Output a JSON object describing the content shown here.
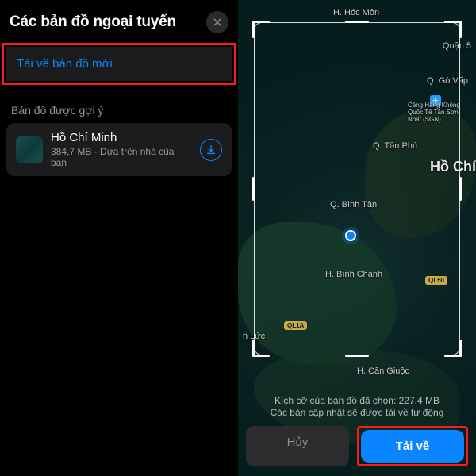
{
  "left": {
    "title": "Các bản đồ ngoại tuyến",
    "new_map_label": "Tải về bản đồ mới",
    "suggested_header": "Bản đồ được gợi ý",
    "suggested": {
      "name": "Hồ Chí Minh",
      "meta": "384,7 MB · Dựa trên nhà của bạn"
    }
  },
  "right": {
    "labels": {
      "hoc_mon": "H. Hóc Môn",
      "quan5": "Quận 5",
      "go_vap": "Q. Gò Vấp",
      "airport": "Cảng Hàng Không Quốc Tế Tân Sơn Nhất (SGN)",
      "tan_phu": "Q. Tân Phú",
      "ho_chi": "Hồ Chí",
      "binh_tan": "Q. Bình Tân",
      "binh_chanh": "H. Bình Chánh",
      "ql50": "QL50",
      "ql1a": "QL1A",
      "can_giuoc": "H. Cần Giuộc",
      "n_luc": "n Lức"
    },
    "footer": {
      "size_line": "Kích cỡ của bản đồ đã chọn: 227,4 MB",
      "update_line": "Các bản cập nhật sẽ được tải về tự động",
      "cancel": "Hủy",
      "download": "Tải về"
    }
  }
}
